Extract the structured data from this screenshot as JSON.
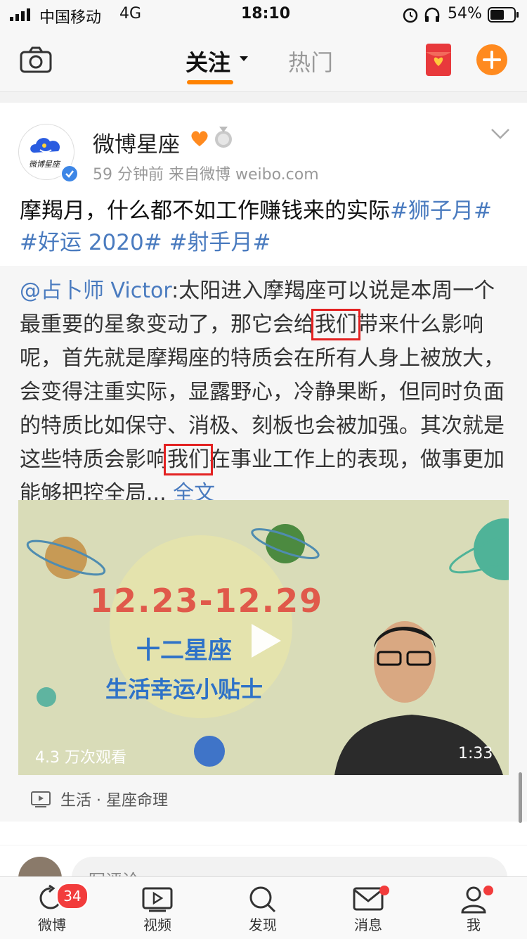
{
  "status_bar": {
    "carrier": "中国移动",
    "network": "4G",
    "time": "18:10",
    "battery": "54%"
  },
  "top_nav": {
    "tabs": [
      {
        "label": "关注",
        "active": true
      },
      {
        "label": "热门",
        "active": false
      }
    ],
    "accent_color": "#ff8200"
  },
  "post": {
    "author": "微博星座",
    "avatar_text": "微博星座",
    "meta": "59 分钟前  来自微博 weibo.com",
    "text": "摩羯月，什么都不如工作赚钱来的实际",
    "hashtags": [
      "#狮子月#",
      "#好运 2020#",
      "#射手月#"
    ],
    "repost": {
      "mention": "@占卜师 Victor",
      "seg1": ":太阳进入摩羯座可以说是本周一个最重要的星象变动了，那它会给",
      "hl1": "我们",
      "seg2": "带来什么影响呢，首先就是摩羯座的特质会在所有人身上被放大，会变得注重实际，显露野心，冷静果断，但同时负面的特质比如保守、消极、刻板也会被加强。其次就是这些特质会影响",
      "hl2": "我们",
      "seg3": "在事业工作上的表现，做事更加能够把控全局...",
      "more": "全文",
      "video": {
        "date_range": "12.23-12.29",
        "subtitle": "十二星座",
        "caption": "生活幸运小贴士",
        "views": "4.3 万次观看",
        "duration": "1:33"
      },
      "category": "生活 · 星座命理"
    }
  },
  "comment": {
    "placeholder": "写评论..."
  },
  "bottom_bar": {
    "items": [
      {
        "label": "微博",
        "badge": "34"
      },
      {
        "label": "视频"
      },
      {
        "label": "发现"
      },
      {
        "label": "消息"
      },
      {
        "label": "我"
      }
    ]
  }
}
